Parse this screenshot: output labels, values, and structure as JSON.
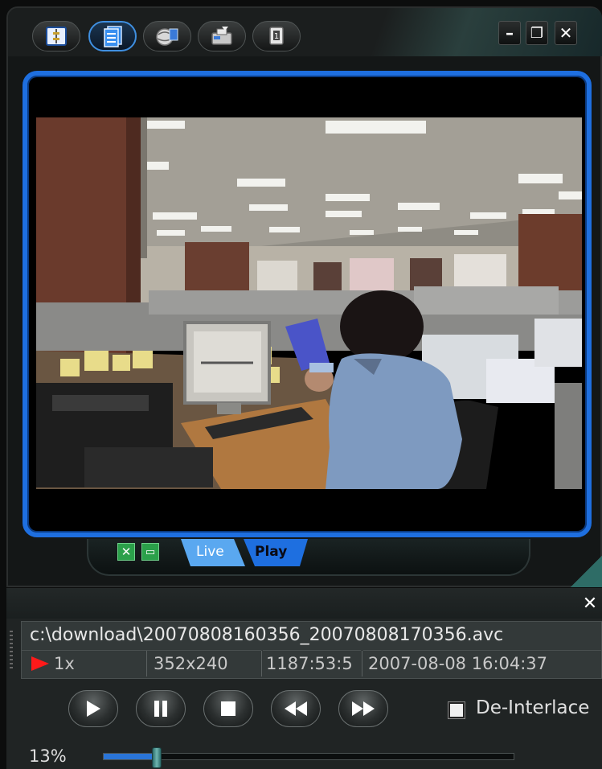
{
  "toolbar": {
    "buttons": [
      {
        "name": "config-icon",
        "active": false
      },
      {
        "name": "record-list-icon",
        "active": true
      },
      {
        "name": "network-icon",
        "active": false
      },
      {
        "name": "snapshot-icon",
        "active": false
      },
      {
        "name": "info-icon",
        "active": false
      }
    ],
    "minimize": "–",
    "restore": "❐",
    "close": "✕"
  },
  "view_switch": {
    "fullscreen_label": "✕",
    "window_label": "▭",
    "live_label": "Live",
    "play_label": "Play"
  },
  "panel": {
    "close": "✕",
    "file_path": "c:\\download\\20070808160356_20070808170356.avc",
    "speed": "1x",
    "resolution": "352x240",
    "elapsed": "1187:53:5",
    "timestamp": "2007-08-08 16:04:37"
  },
  "controls": {
    "buttons": [
      "play",
      "pause",
      "stop",
      "rewind",
      "fast-forward"
    ],
    "deinterlace_label": "De-Interlace",
    "deinterlace_checked": false
  },
  "progress": {
    "label": "13%",
    "value": 0.13
  },
  "colors": {
    "accent": "#1e6fe0",
    "live_tab": "#5aa8f0",
    "play_tab": "#1e6fe0",
    "speed_arrow": "#ff1a1a"
  }
}
